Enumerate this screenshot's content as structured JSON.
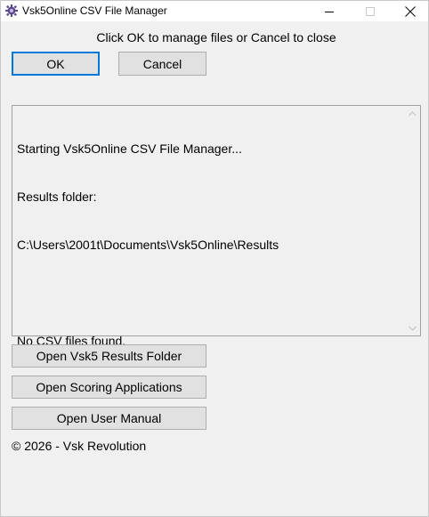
{
  "window": {
    "title": "Vsk5Online CSV File Manager",
    "app_icon": "gear-app-icon",
    "controls": {
      "minimize_icon": "minimize-icon",
      "maximize_icon": "maximize-icon",
      "close_icon": "close-icon"
    }
  },
  "instruction": "Click OK to manage files or Cancel to close",
  "buttons": {
    "ok": "OK",
    "cancel": "Cancel",
    "open_results": "Open Vsk5 Results Folder",
    "open_scoring": "Open Scoring Applications",
    "open_manual": "Open User Manual"
  },
  "log": {
    "lines": [
      "Starting Vsk5Online CSV File Manager...",
      "Results folder:",
      "C:\\Users\\2001t\\Documents\\Vsk5Online\\Results",
      "",
      "No CSV files found."
    ]
  },
  "footer": {
    "copyright": "© 2026 - Vsk Revolution"
  },
  "colors": {
    "window_bg": "#f0f0f0",
    "button_bg": "#e1e1e1",
    "button_border": "#adadad",
    "focus_border": "#0078d7"
  }
}
